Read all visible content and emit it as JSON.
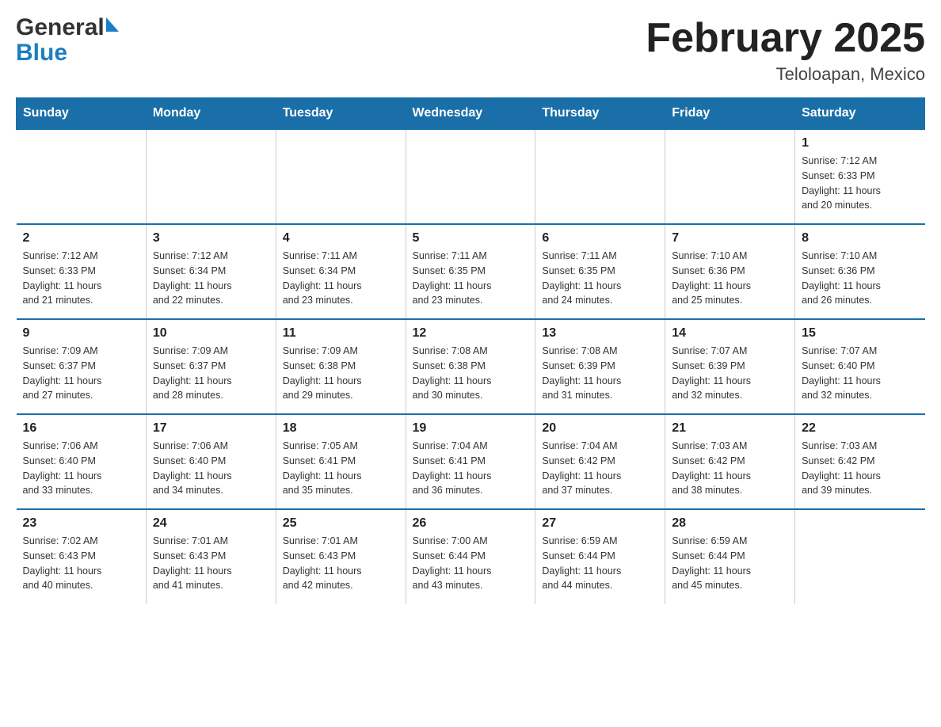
{
  "header": {
    "logo_general": "General",
    "logo_blue": "Blue",
    "title": "February 2025",
    "subtitle": "Teloloapan, Mexico"
  },
  "days_of_week": [
    "Sunday",
    "Monday",
    "Tuesday",
    "Wednesday",
    "Thursday",
    "Friday",
    "Saturday"
  ],
  "weeks": [
    [
      {
        "day": "",
        "info": ""
      },
      {
        "day": "",
        "info": ""
      },
      {
        "day": "",
        "info": ""
      },
      {
        "day": "",
        "info": ""
      },
      {
        "day": "",
        "info": ""
      },
      {
        "day": "",
        "info": ""
      },
      {
        "day": "1",
        "info": "Sunrise: 7:12 AM\nSunset: 6:33 PM\nDaylight: 11 hours\nand 20 minutes."
      }
    ],
    [
      {
        "day": "2",
        "info": "Sunrise: 7:12 AM\nSunset: 6:33 PM\nDaylight: 11 hours\nand 21 minutes."
      },
      {
        "day": "3",
        "info": "Sunrise: 7:12 AM\nSunset: 6:34 PM\nDaylight: 11 hours\nand 22 minutes."
      },
      {
        "day": "4",
        "info": "Sunrise: 7:11 AM\nSunset: 6:34 PM\nDaylight: 11 hours\nand 23 minutes."
      },
      {
        "day": "5",
        "info": "Sunrise: 7:11 AM\nSunset: 6:35 PM\nDaylight: 11 hours\nand 23 minutes."
      },
      {
        "day": "6",
        "info": "Sunrise: 7:11 AM\nSunset: 6:35 PM\nDaylight: 11 hours\nand 24 minutes."
      },
      {
        "day": "7",
        "info": "Sunrise: 7:10 AM\nSunset: 6:36 PM\nDaylight: 11 hours\nand 25 minutes."
      },
      {
        "day": "8",
        "info": "Sunrise: 7:10 AM\nSunset: 6:36 PM\nDaylight: 11 hours\nand 26 minutes."
      }
    ],
    [
      {
        "day": "9",
        "info": "Sunrise: 7:09 AM\nSunset: 6:37 PM\nDaylight: 11 hours\nand 27 minutes."
      },
      {
        "day": "10",
        "info": "Sunrise: 7:09 AM\nSunset: 6:37 PM\nDaylight: 11 hours\nand 28 minutes."
      },
      {
        "day": "11",
        "info": "Sunrise: 7:09 AM\nSunset: 6:38 PM\nDaylight: 11 hours\nand 29 minutes."
      },
      {
        "day": "12",
        "info": "Sunrise: 7:08 AM\nSunset: 6:38 PM\nDaylight: 11 hours\nand 30 minutes."
      },
      {
        "day": "13",
        "info": "Sunrise: 7:08 AM\nSunset: 6:39 PM\nDaylight: 11 hours\nand 31 minutes."
      },
      {
        "day": "14",
        "info": "Sunrise: 7:07 AM\nSunset: 6:39 PM\nDaylight: 11 hours\nand 32 minutes."
      },
      {
        "day": "15",
        "info": "Sunrise: 7:07 AM\nSunset: 6:40 PM\nDaylight: 11 hours\nand 32 minutes."
      }
    ],
    [
      {
        "day": "16",
        "info": "Sunrise: 7:06 AM\nSunset: 6:40 PM\nDaylight: 11 hours\nand 33 minutes."
      },
      {
        "day": "17",
        "info": "Sunrise: 7:06 AM\nSunset: 6:40 PM\nDaylight: 11 hours\nand 34 minutes."
      },
      {
        "day": "18",
        "info": "Sunrise: 7:05 AM\nSunset: 6:41 PM\nDaylight: 11 hours\nand 35 minutes."
      },
      {
        "day": "19",
        "info": "Sunrise: 7:04 AM\nSunset: 6:41 PM\nDaylight: 11 hours\nand 36 minutes."
      },
      {
        "day": "20",
        "info": "Sunrise: 7:04 AM\nSunset: 6:42 PM\nDaylight: 11 hours\nand 37 minutes."
      },
      {
        "day": "21",
        "info": "Sunrise: 7:03 AM\nSunset: 6:42 PM\nDaylight: 11 hours\nand 38 minutes."
      },
      {
        "day": "22",
        "info": "Sunrise: 7:03 AM\nSunset: 6:42 PM\nDaylight: 11 hours\nand 39 minutes."
      }
    ],
    [
      {
        "day": "23",
        "info": "Sunrise: 7:02 AM\nSunset: 6:43 PM\nDaylight: 11 hours\nand 40 minutes."
      },
      {
        "day": "24",
        "info": "Sunrise: 7:01 AM\nSunset: 6:43 PM\nDaylight: 11 hours\nand 41 minutes."
      },
      {
        "day": "25",
        "info": "Sunrise: 7:01 AM\nSunset: 6:43 PM\nDaylight: 11 hours\nand 42 minutes."
      },
      {
        "day": "26",
        "info": "Sunrise: 7:00 AM\nSunset: 6:44 PM\nDaylight: 11 hours\nand 43 minutes."
      },
      {
        "day": "27",
        "info": "Sunrise: 6:59 AM\nSunset: 6:44 PM\nDaylight: 11 hours\nand 44 minutes."
      },
      {
        "day": "28",
        "info": "Sunrise: 6:59 AM\nSunset: 6:44 PM\nDaylight: 11 hours\nand 45 minutes."
      },
      {
        "day": "",
        "info": ""
      }
    ]
  ]
}
